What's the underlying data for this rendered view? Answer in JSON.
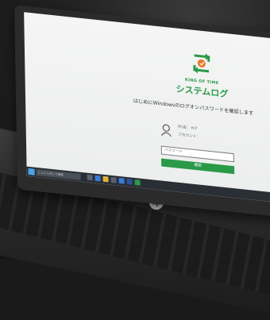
{
  "login": {
    "brand_small": "KING OF TIME",
    "brand_title": "システムログ",
    "prompt": "はじめにWindowsのログオンパスワードを確認します",
    "pc_label": "PC名： H-T",
    "account_label": "アカウント：",
    "password_placeholder": "パスワード",
    "confirm_label": "確認"
  },
  "taskbar": {
    "search_text": "ここに入力して検索"
  },
  "laptop": {
    "logo_text": "hp"
  },
  "colors": {
    "brand_green": "#2a9a48",
    "screen_bg": "#eef0ef"
  }
}
